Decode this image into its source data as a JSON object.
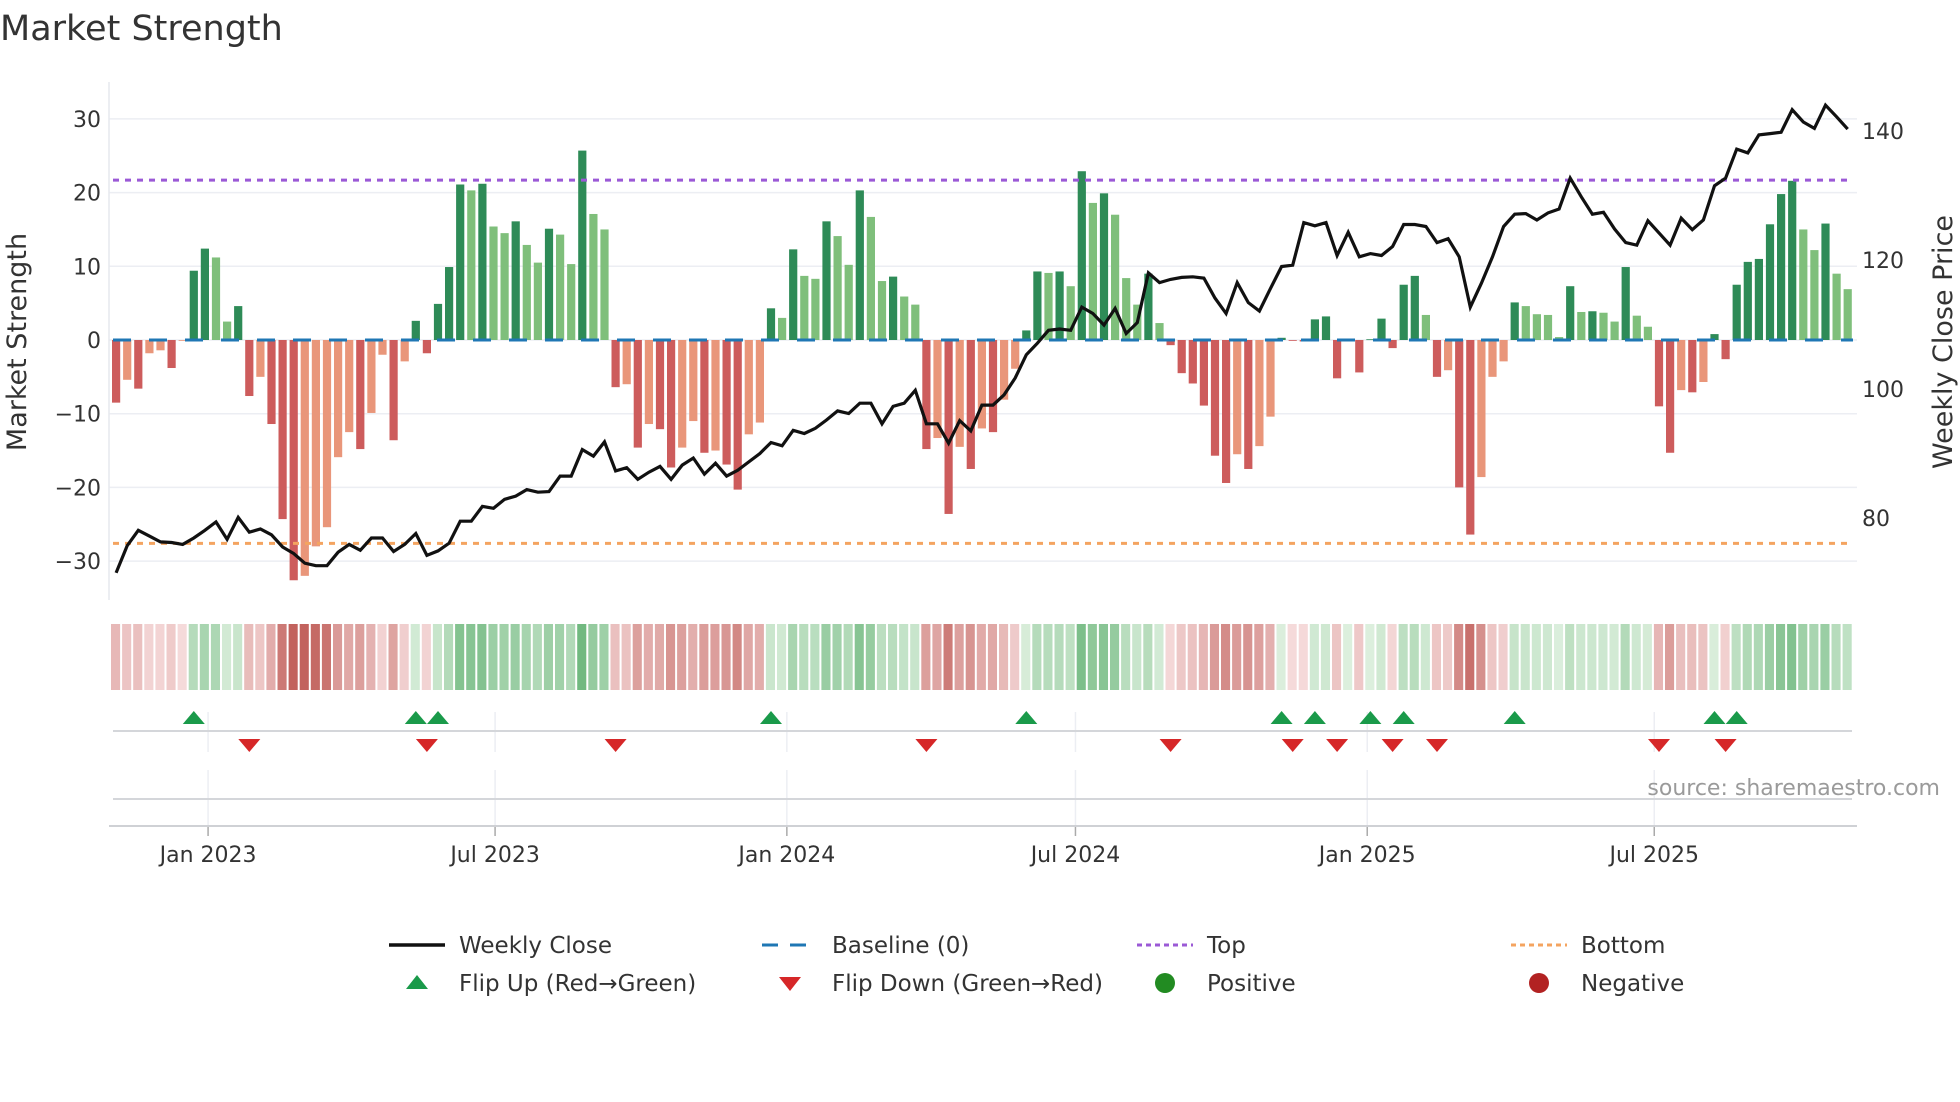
{
  "chart_data": {
    "type": "bar",
    "title": "Market Strength",
    "ylabel": "Market Strength",
    "y2label": "Weekly Close Price",
    "ylim": [
      -35,
      35
    ],
    "y2lim": [
      69,
      146
    ],
    "yticks": [
      30,
      20,
      10,
      0,
      -10,
      -20,
      -30
    ],
    "ytick_labels": [
      "30",
      "20",
      "10",
      "0",
      "−10",
      "−20",
      "−30"
    ],
    "y2ticks": [
      140,
      120,
      100,
      80
    ],
    "y2tick_labels": [
      "140",
      "120",
      "100",
      "80"
    ],
    "x_start": "2022-11-04",
    "x_interval_days": 7,
    "xticks": [
      {
        "date": "2023-01-01",
        "label": "Jan 2023"
      },
      {
        "date": "2023-07-01",
        "label": "Jul 2023"
      },
      {
        "date": "2024-01-01",
        "label": "Jan 2024"
      },
      {
        "date": "2024-07-01",
        "label": "Jul 2024"
      },
      {
        "date": "2025-01-01",
        "label": "Jan 2025"
      },
      {
        "date": "2025-07-01",
        "label": "Jul 2025"
      }
    ],
    "top_level": 21.7,
    "bottom_level": -27.6,
    "baseline": 0,
    "strength": [
      -8.5,
      -5.4,
      -6.6,
      -1.8,
      -1.4,
      -3.8,
      -0.1,
      9.4,
      12.4,
      11.2,
      2.5,
      4.6,
      -7.6,
      -5.0,
      -11.4,
      -24.3,
      -32.6,
      -32.0,
      -28.0,
      -25.4,
      -15.9,
      -12.5,
      -14.8,
      -9.9,
      -2.0,
      -13.6,
      -2.9,
      2.6,
      -1.8,
      4.9,
      9.9,
      21.1,
      20.3,
      21.2,
      15.4,
      14.5,
      16.1,
      12.9,
      10.5,
      15.1,
      14.3,
      10.3,
      25.7,
      17.1,
      15.0,
      -6.4,
      -6.0,
      -14.6,
      -11.4,
      -12.1,
      -17.3,
      -14.6,
      -11.0,
      -15.3,
      -15.0,
      -16.9,
      -20.3,
      -12.8,
      -11.2,
      4.3,
      3.0,
      12.3,
      8.7,
      8.3,
      16.1,
      14.1,
      10.2,
      20.3,
      16.7,
      8.0,
      8.6,
      5.9,
      4.8,
      -14.8,
      -13.3,
      -23.6,
      -14.5,
      -17.5,
      -12.0,
      -12.5,
      -8.1,
      -3.9,
      1.3,
      9.3,
      9.1,
      9.3,
      7.3,
      22.9,
      18.6,
      19.9,
      17.0,
      8.4,
      4.8,
      9.0,
      2.3,
      -0.7,
      -4.5,
      -5.9,
      -8.9,
      -15.7,
      -19.4,
      -15.5,
      -17.5,
      -14.4,
      -10.4,
      0.3,
      -0.1,
      -0.2,
      2.8,
      3.2,
      -5.2,
      0,
      -4.4,
      0.1,
      2.9,
      -1.1,
      7.5,
      8.7,
      3.4,
      -5.0,
      -4.1,
      -20.0,
      -26.4,
      -18.6,
      -5.0,
      -2.9,
      5.1,
      4.6,
      3.5,
      3.4,
      0.4,
      7.3,
      3.8,
      3.9,
      3.7,
      2.5,
      9.9,
      3.3,
      1.8,
      -9.0,
      -15.3,
      -6.8,
      -7.1,
      -5.7,
      0.8,
      -2.6,
      7.5,
      10.6,
      11.0,
      15.7,
      19.8,
      21.6,
      15.0,
      12.2,
      15.8,
      9.0,
      6.9
    ],
    "weekly_close": [
      71.5,
      75.7,
      78.1,
      77.2,
      76.3,
      76.2,
      75.9,
      76.9,
      78.1,
      79.4,
      76.7,
      80.1,
      77.8,
      78.3,
      77.4,
      75.5,
      74.5,
      73.0,
      72.6,
      72.6,
      74.7,
      75.9,
      75.0,
      76.9,
      76.9,
      74.8,
      75.9,
      77.6,
      74.2,
      74.9,
      76.1,
      79.5,
      79.5,
      81.8,
      81.5,
      82.9,
      83.4,
      84.4,
      84.0,
      84.1,
      86.5,
      86.5,
      90.6,
      89.6,
      91.8,
      87.3,
      87.8,
      86.0,
      87.1,
      88.0,
      86.0,
      88.2,
      89.3,
      86.8,
      88.5,
      86.5,
      87.4,
      88.7,
      90.0,
      91.7,
      91.2,
      93.6,
      93.1,
      93.9,
      95.2,
      96.6,
      96.2,
      97.8,
      97.8,
      94.6,
      97.3,
      97.8,
      99.8,
      94.6,
      94.6,
      91.6,
      95.1,
      93.5,
      97.5,
      97.5,
      99.1,
      101.7,
      105.3,
      107.1,
      109.1,
      109.3,
      109.1,
      112.7,
      111.7,
      109.9,
      112.5,
      108.6,
      110.3,
      118.0,
      116.5,
      117.0,
      117.3,
      117.4,
      117.2,
      114.1,
      111.7,
      116.5,
      113.4,
      112.1,
      115.6,
      119.0,
      119.2,
      125.8,
      125.3,
      125.8,
      120.7,
      124.3,
      120.5,
      121.0,
      120.7,
      122.1,
      125.5,
      125.5,
      125.2,
      122.7,
      123.3,
      120.5,
      112.7,
      116.4,
      120.5,
      125.2,
      127.1,
      127.2,
      126.2,
      127.3,
      127.9,
      132.7,
      129.8,
      127.1,
      127.4,
      124.8,
      122.7,
      122.3,
      126.1,
      124.2,
      122.3,
      126.5,
      124.7,
      126.2,
      131.5,
      132.7,
      137.2,
      136.6,
      139.4,
      139.6,
      139.8,
      143.3,
      141.4,
      140.4,
      144.0,
      142.2,
      140.3
    ],
    "flip_up_weeks": [
      8,
      28,
      30,
      60,
      83,
      106,
      109,
      114,
      117,
      127,
      145,
      147
    ],
    "flip_down_weeks": [
      13,
      29,
      46,
      74,
      96,
      107,
      111,
      116,
      120,
      140,
      146
    ],
    "legend_position": "bottom",
    "legend": [
      {
        "key": "close",
        "label": "Weekly Close"
      },
      {
        "key": "baseline",
        "label": "Baseline (0)"
      },
      {
        "key": "top",
        "label": "Top"
      },
      {
        "key": "bottom",
        "label": "Bottom"
      },
      {
        "key": "flip_up",
        "label": "Flip Up (Red→Green)"
      },
      {
        "key": "flip_down",
        "label": "Flip Down (Green→Red)"
      },
      {
        "key": "positive",
        "label": "Positive"
      },
      {
        "key": "negative",
        "label": "Negative"
      }
    ],
    "colors": {
      "pos_dark": "#2e8b57",
      "pos_light": "#7fbf7b",
      "neg_dark": "#cd5c5c",
      "neg_light": "#e9967a",
      "close": "#111111",
      "baseline": "#1f77b4",
      "top": "#9b59d6",
      "bottom": "#f4a460",
      "flip_up": "#1a9a4a",
      "flip_down": "#d62728",
      "positive": "#228b22",
      "negative": "#b22222"
    }
  },
  "source": "source: sharemaestro.com"
}
